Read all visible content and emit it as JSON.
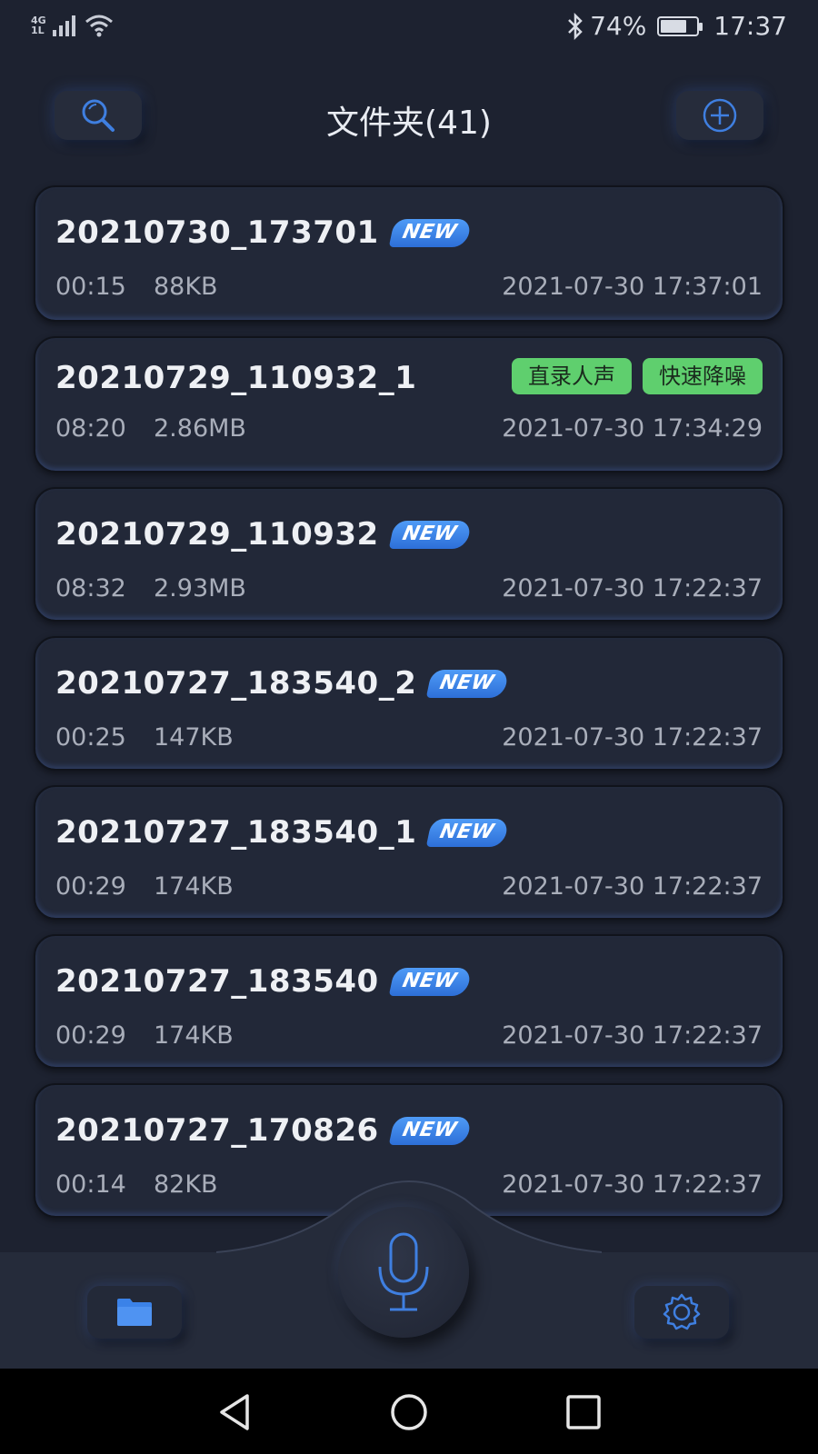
{
  "status_bar": {
    "network_top": "4G",
    "network_bottom": "1L",
    "battery": "74%",
    "battery_level": 0.74,
    "time": "17:37",
    "icons": [
      "signal-icon",
      "wifi-icon",
      "bluetooth-icon",
      "battery-icon"
    ]
  },
  "header": {
    "title": "文件夹(41)",
    "left_icon": "search-icon",
    "right_icon": "add-icon"
  },
  "recordings": [
    {
      "name": "20210730_173701",
      "badge": "NEW",
      "duration": "00:15",
      "size": "88KB",
      "date": "2021-07-30 17:37:01"
    },
    {
      "name": "20210729_110932_1",
      "tags": [
        "直录人声",
        "快速降噪"
      ],
      "duration": "08:20",
      "size": "2.86MB",
      "date": "2021-07-30 17:34:29"
    },
    {
      "name": "20210729_110932",
      "badge": "NEW",
      "duration": "08:32",
      "size": "2.93MB",
      "date": "2021-07-30 17:22:37"
    },
    {
      "name": "20210727_183540_2",
      "badge": "NEW",
      "duration": "00:25",
      "size": "147KB",
      "date": "2021-07-30 17:22:37"
    },
    {
      "name": "20210727_183540_1",
      "badge": "NEW",
      "duration": "00:29",
      "size": "174KB",
      "date": "2021-07-30 17:22:37"
    },
    {
      "name": "20210727_183540",
      "badge": "NEW",
      "duration": "00:29",
      "size": "174KB",
      "date": "2021-07-30 17:22:37"
    },
    {
      "name": "20210727_170826",
      "badge": "NEW",
      "duration": "00:14",
      "size": "82KB",
      "date": "2021-07-30 17:22:37"
    }
  ],
  "bottom_nav": {
    "left_icon": "folder-icon",
    "center_icon": "microphone-icon",
    "right_icon": "settings-icon"
  },
  "colors": {
    "background": "#1d2230",
    "accent": "#3f7fe0",
    "tag_green": "#5fcf6e",
    "badge_blue": "#3b82e8"
  }
}
